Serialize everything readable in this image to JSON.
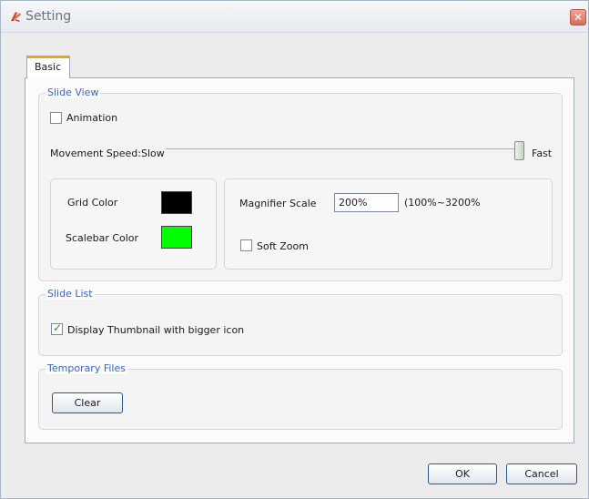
{
  "window": {
    "title": "Setting",
    "icons": {
      "app": "app-logo-icon",
      "close": "close-icon"
    },
    "close_glyph": "✕"
  },
  "tabs": [
    {
      "label": "Basic",
      "selected": true
    }
  ],
  "slide_view": {
    "legend": "Slide View",
    "animation": {
      "label": "Animation",
      "checked": false
    },
    "movement_speed": {
      "label": "Movement Speed:",
      "min_label": "Slow",
      "max_label": "Fast",
      "value_fraction": 1.0
    },
    "grid_color": {
      "label": "Grid Color",
      "color": "#000000"
    },
    "scalebar_color": {
      "label": "Scalebar Color",
      "color": "#00ff00"
    },
    "magnifier_scale": {
      "label": "Magnifier Scale",
      "value": "200%",
      "range_hint": "(100%~3200%"
    },
    "soft_zoom": {
      "label": "Soft Zoom",
      "checked": false
    }
  },
  "slide_list": {
    "legend": "Slide List",
    "display_thumbnail": {
      "label": "Display Thumbnail with bigger icon",
      "checked": true
    }
  },
  "temporary_files": {
    "legend": "Temporary Files",
    "clear_label": "Clear"
  },
  "footer": {
    "ok_label": "OK",
    "cancel_label": "Cancel"
  },
  "colors": {
    "legend_text": "#3a66c4",
    "tab_accent": "#f0a020",
    "button_border": "#2a5a94"
  }
}
